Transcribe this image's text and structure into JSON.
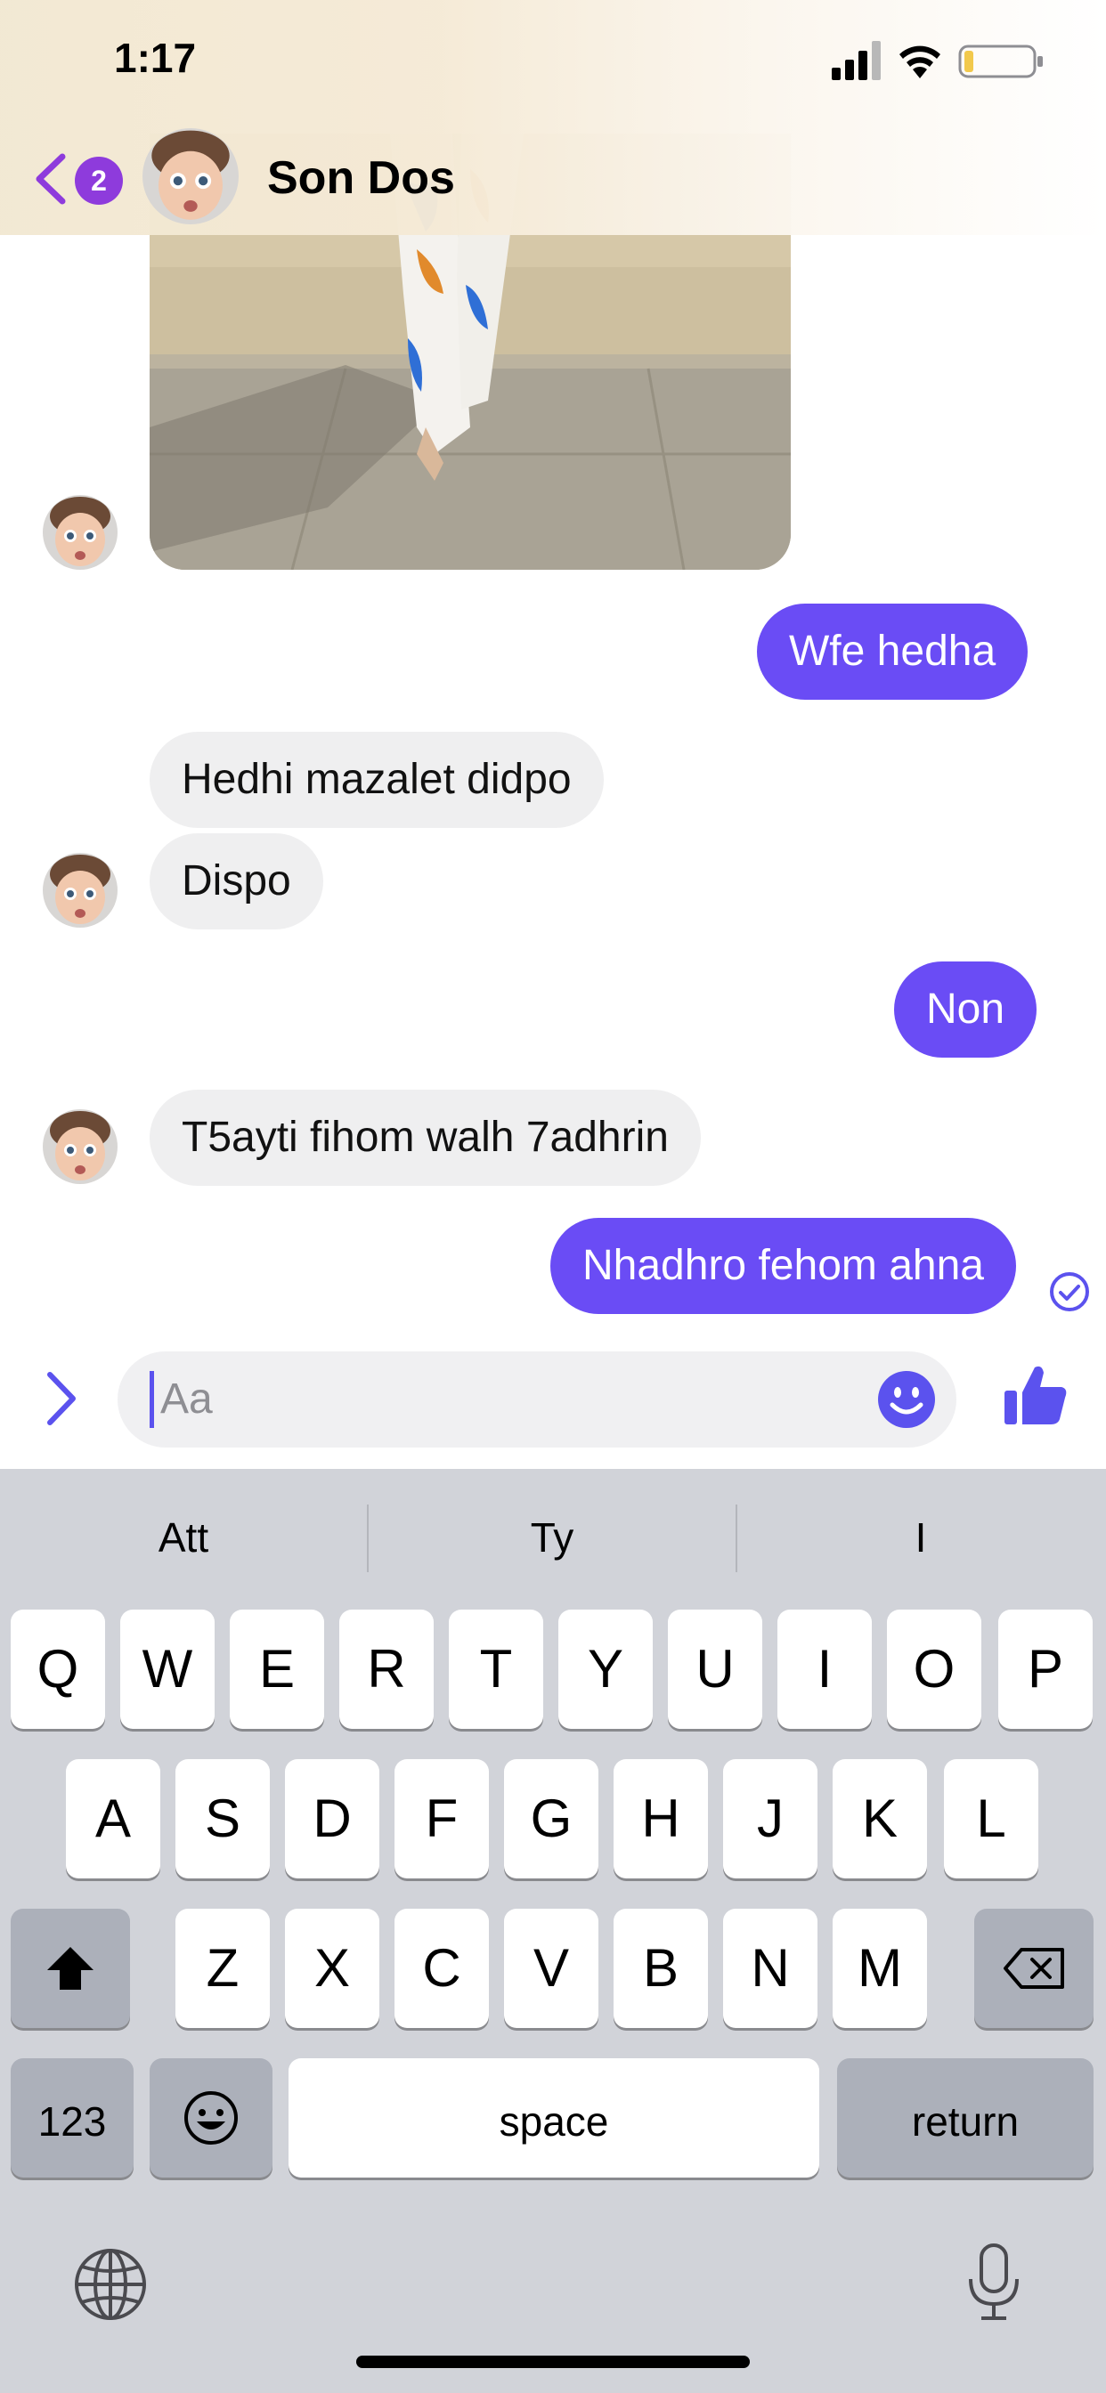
{
  "status_bar": {
    "time": "1:17"
  },
  "header": {
    "back_badge_count": "2",
    "contact_name": "Son Dos"
  },
  "messages": [
    {
      "direction": "incoming",
      "type": "photo"
    },
    {
      "direction": "outgoing",
      "text": "Wfe hedha"
    },
    {
      "direction": "incoming",
      "text": "Hedhi mazalet didpo"
    },
    {
      "direction": "incoming",
      "text": "Dispo"
    },
    {
      "direction": "outgoing",
      "text": "Non"
    },
    {
      "direction": "incoming",
      "text": "T5ayti fihom walh 7adhrin"
    },
    {
      "direction": "outgoing",
      "text": "Nhadhro fehom ahna"
    }
  ],
  "composer": {
    "placeholder": "Aa"
  },
  "keyboard": {
    "suggestions": [
      "Att",
      "Ty",
      "I"
    ],
    "row1": [
      "Q",
      "W",
      "E",
      "R",
      "T",
      "Y",
      "U",
      "I",
      "O",
      "P"
    ],
    "row2": [
      "A",
      "S",
      "D",
      "F",
      "G",
      "H",
      "J",
      "K",
      "L"
    ],
    "row3": [
      "Z",
      "X",
      "C",
      "V",
      "B",
      "N",
      "M"
    ],
    "numbers_label": "123",
    "space_label": "space",
    "return_label": "return"
  },
  "colors": {
    "accent": "#6a4cf5",
    "badge": "#8e3bdc",
    "incoming_bubble": "#efeff0"
  }
}
